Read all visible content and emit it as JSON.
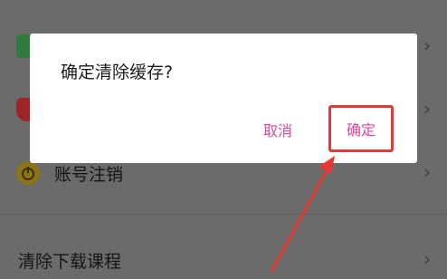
{
  "settings": {
    "items": [
      {
        "label": "",
        "icon": "sheet-icon",
        "color": "#2e8b3e"
      },
      {
        "label": "",
        "icon": "shield-icon",
        "color": "#c62828"
      },
      {
        "label": "账号注销",
        "icon": "power-icon",
        "color": "#b8860b"
      },
      {
        "label": "清除下载课程",
        "icon": "",
        "color": ""
      }
    ],
    "chevron": "›"
  },
  "dialog": {
    "title": "确定清除缓存?",
    "cancel_label": "取消",
    "confirm_label": "确定"
  },
  "colors": {
    "accent": "#e0459a",
    "highlight": "#e53935"
  }
}
